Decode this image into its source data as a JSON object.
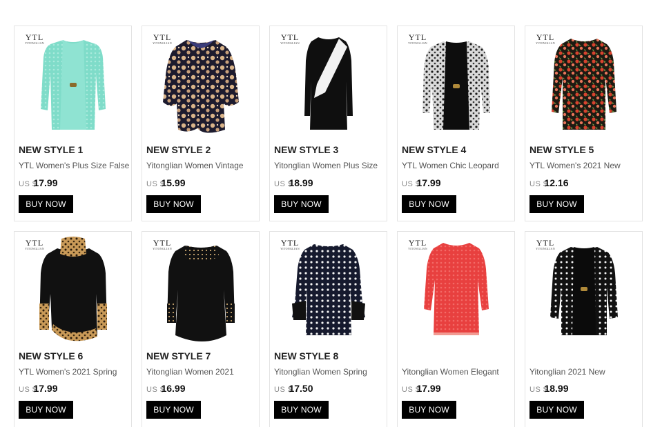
{
  "products": [
    {
      "title": "NEW STYLE 1",
      "desc": "YTL Women's Plus Size False",
      "currency": "US $",
      "price": "17.99",
      "button": "BUY NOW",
      "logo": "YTL",
      "logo_sub": "YITONGLIAN",
      "image": "mint-lace-cardigan-top"
    },
    {
      "title": "NEW STYLE 2",
      "desc": "Yitonglian Women Vintage",
      "currency": "US $",
      "price": "15.99",
      "button": "BUY NOW",
      "logo": "YTL",
      "logo_sub": "YITONGLIAN",
      "image": "navy-floral-chiffon-top"
    },
    {
      "title": "NEW STYLE 3",
      "desc": "Yitonglian Women Plus Size",
      "currency": "US $",
      "price": "18.99",
      "button": "BUY NOW",
      "logo": "YTL",
      "logo_sub": "YITONGLIAN",
      "image": "black-white-diagonal-dress"
    },
    {
      "title": "NEW STYLE 4",
      "desc": "YTL Women Chic Leopard",
      "currency": "US $",
      "price": "17.99",
      "button": "BUY NOW",
      "logo": "YTL",
      "logo_sub": "YITONGLIAN",
      "image": "leopard-cardigan-top"
    },
    {
      "title": "NEW STYLE 5",
      "desc": "YTL Women's 2021 New",
      "currency": "US $",
      "price": "12.16",
      "button": "BUY NOW",
      "logo": "YTL",
      "logo_sub": "YITONGLIAN",
      "image": "red-floral-top"
    },
    {
      "title": "NEW STYLE 6",
      "desc": "YTL Women's 2021 Spring",
      "currency": "US $",
      "price": "17.99",
      "button": "BUY NOW",
      "logo": "YTL",
      "logo_sub": "YITONGLIAN",
      "image": "black-leopard-turtleneck"
    },
    {
      "title": "NEW STYLE 7",
      "desc": "Yitonglian Women 2021",
      "currency": "US $",
      "price": "16.99",
      "button": "BUY NOW",
      "logo": "YTL",
      "logo_sub": "YITONGLIAN",
      "image": "black-dotted-tunic"
    },
    {
      "title": "NEW STYLE 8",
      "desc": "Yitonglian Women Spring",
      "currency": "US $",
      "price": "17.50",
      "button": "BUY NOW",
      "logo": "YTL",
      "logo_sub": "YITONGLIAN",
      "image": "navy-polka-dot-top"
    },
    {
      "title": "",
      "desc": "Yitonglian Women Elegant",
      "currency": "US $",
      "price": "17.99",
      "button": "BUY NOW",
      "logo": "YTL",
      "logo_sub": "YITONGLIAN",
      "image": "red-lace-top"
    },
    {
      "title": "",
      "desc": "Yitonglian 2021 New",
      "currency": "US $",
      "price": "18.99",
      "button": "BUY NOW",
      "logo": "YTL",
      "logo_sub": "YITONGLIAN",
      "image": "polka-dot-cardigan-top"
    }
  ],
  "colors": {
    "button_bg": "#000000",
    "button_text": "#ffffff",
    "border": "#e3e3e3"
  }
}
